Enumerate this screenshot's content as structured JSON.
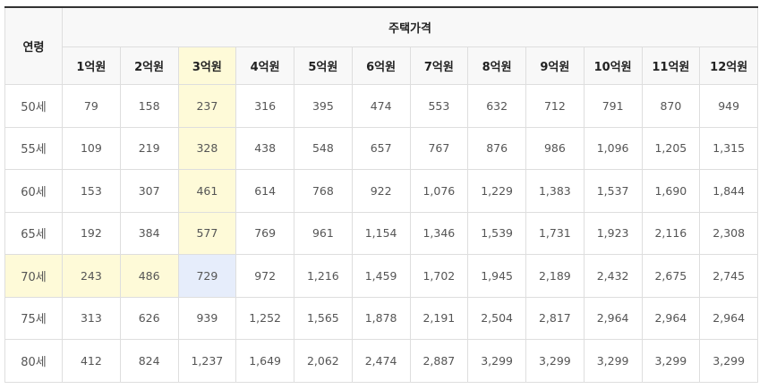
{
  "table": {
    "age_header": "연령",
    "price_header": "주택가격",
    "price_columns": [
      "1억원",
      "2억원",
      "3억원",
      "4억원",
      "5억원",
      "6억원",
      "7억원",
      "8억원",
      "9억원",
      "10억원",
      "11억원",
      "12억원"
    ],
    "rows": [
      {
        "age": "50세",
        "values": [
          "79",
          "158",
          "237",
          "316",
          "395",
          "474",
          "553",
          "632",
          "712",
          "791",
          "870",
          "949"
        ]
      },
      {
        "age": "55세",
        "values": [
          "109",
          "219",
          "328",
          "438",
          "548",
          "657",
          "767",
          "876",
          "986",
          "1,096",
          "1,205",
          "1,315"
        ]
      },
      {
        "age": "60세",
        "values": [
          "153",
          "307",
          "461",
          "614",
          "768",
          "922",
          "1,076",
          "1,229",
          "1,383",
          "1,537",
          "1,690",
          "1,844"
        ]
      },
      {
        "age": "65세",
        "values": [
          "192",
          "384",
          "577",
          "769",
          "961",
          "1,154",
          "1,346",
          "1,539",
          "1,731",
          "1,923",
          "2,116",
          "2,308"
        ]
      },
      {
        "age": "70세",
        "values": [
          "243",
          "486",
          "729",
          "972",
          "1,216",
          "1,459",
          "1,702",
          "1,945",
          "2,189",
          "2,432",
          "2,675",
          "2,745"
        ]
      },
      {
        "age": "75세",
        "values": [
          "313",
          "626",
          "939",
          "1,252",
          "1,565",
          "1,878",
          "2,191",
          "2,504",
          "2,817",
          "2,964",
          "2,964",
          "2,964"
        ]
      },
      {
        "age": "80세",
        "values": [
          "412",
          "824",
          "1,237",
          "1,649",
          "2,062",
          "2,474",
          "2,887",
          "3,299",
          "3,299",
          "3,299",
          "3,299",
          "3,299"
        ]
      }
    ],
    "highlight": {
      "column_index": 2,
      "row_index": 4,
      "colors": {
        "yellow": "#fefad8",
        "blue": "#e6edfb",
        "header_border": "#333333",
        "grid": "#dedede"
      }
    }
  }
}
